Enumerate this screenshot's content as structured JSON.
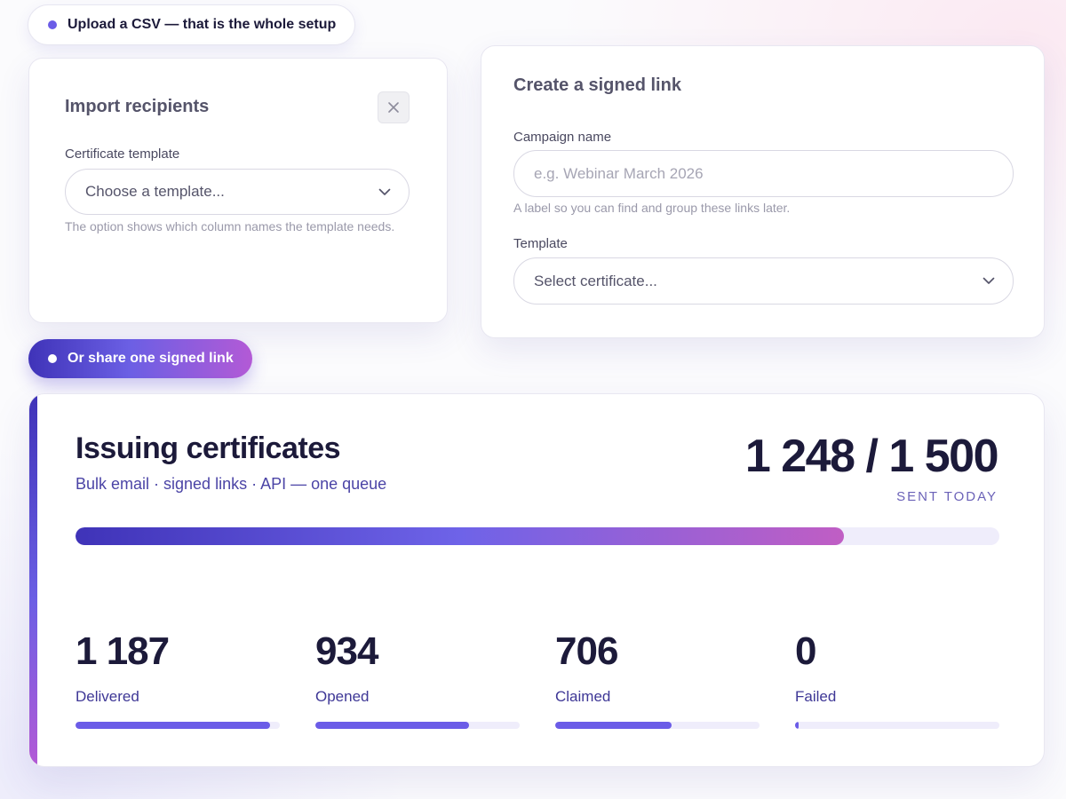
{
  "pills": {
    "upload_label": "Upload a CSV — that is the whole setup",
    "share_label": "Or share one signed link"
  },
  "import_card": {
    "title": "Import recipients",
    "close_icon": "close-icon",
    "template_label": "Certificate template",
    "template_select": "Choose a template...",
    "template_hint": "The option shows which column names the template needs."
  },
  "link_card": {
    "title": "Create a signed link",
    "campaign_label": "Campaign name",
    "campaign_value": "",
    "campaign_placeholder": "e.g. Webinar March 2026",
    "campaign_hint": "A label so you can find and group these links later.",
    "template_label": "Template",
    "template_select": "Select certificate..."
  },
  "issuing": {
    "title": "Issuing certificates",
    "subtitle": "Bulk email · signed links · API — one queue",
    "count_text": "1 248 / 1 500",
    "count_caption": "SENT TODAY",
    "sent": 1248,
    "total": 1500,
    "progress_fraction": 0.832
  },
  "stats": [
    {
      "value": "1 187",
      "label": "Delivered",
      "fraction": 0.952
    },
    {
      "value": "934",
      "label": "Opened",
      "fraction": 0.752
    },
    {
      "value": "706",
      "label": "Claimed",
      "fraction": 0.57
    },
    {
      "value": "0",
      "label": "Failed",
      "fraction": 0.017
    }
  ],
  "colors": {
    "accent": "#6b5ce7",
    "brand_dark": "#3f33b8",
    "brand_pink": "#b35ad6",
    "track": "#efedfb"
  }
}
